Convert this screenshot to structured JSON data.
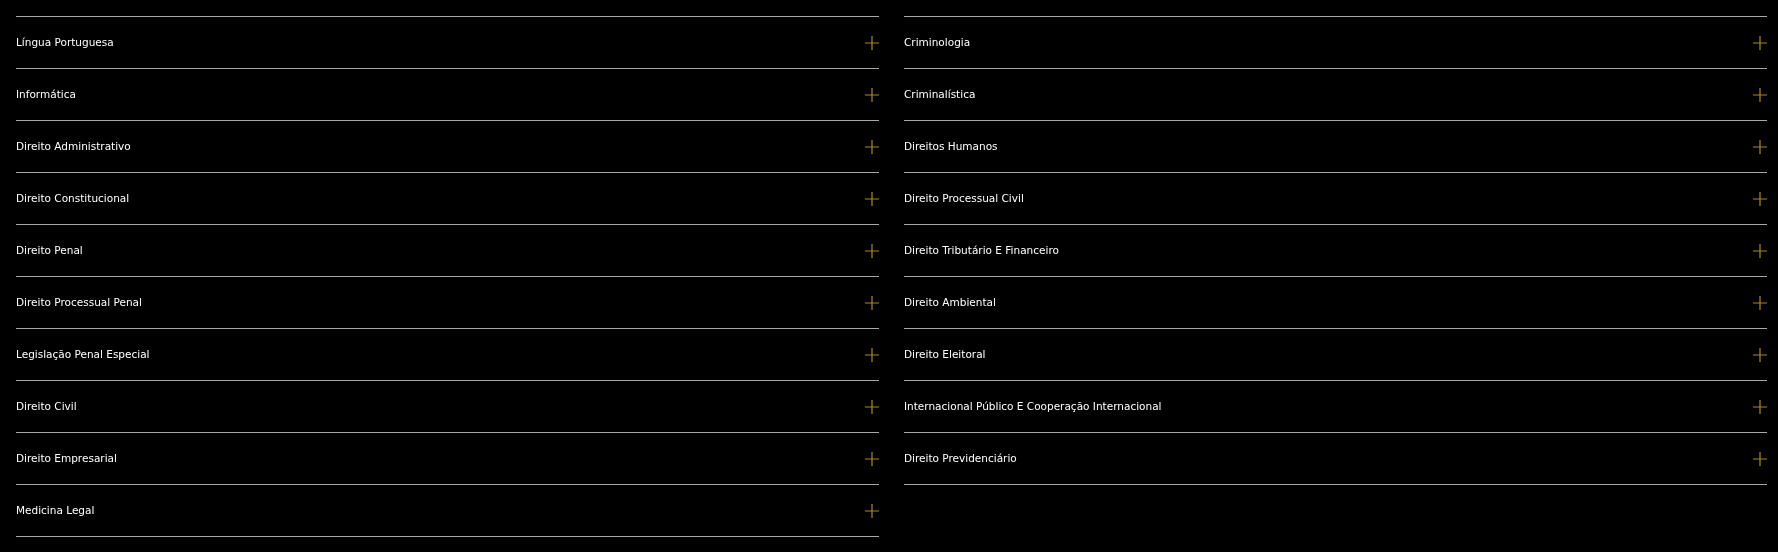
{
  "columns": [
    {
      "items": [
        {
          "label": "Língua Portuguesa",
          "expanded": false
        },
        {
          "label": "Informática",
          "expanded": false
        },
        {
          "label": "Direito Administrativo",
          "expanded": false
        },
        {
          "label": "Direito Constitucional",
          "expanded": false
        },
        {
          "label": "Direito Penal",
          "expanded": false
        },
        {
          "label": "Direito Processual Penal",
          "expanded": false
        },
        {
          "label": "Legislação Penal Especial",
          "expanded": false
        },
        {
          "label": "Direito Civil",
          "expanded": false
        },
        {
          "label": "Direito Empresarial",
          "expanded": false
        },
        {
          "label": "Medicina Legal",
          "expanded": false
        }
      ]
    },
    {
      "items": [
        {
          "label": "Criminologia",
          "expanded": false
        },
        {
          "label": "Criminalística",
          "expanded": false
        },
        {
          "label": "Direitos Humanos",
          "expanded": false
        },
        {
          "label": "Direito Processual Civil",
          "expanded": false
        },
        {
          "label": "Direito Tributário E Financeiro",
          "expanded": false
        },
        {
          "label": "Direito Ambiental",
          "expanded": false
        },
        {
          "label": "Direito Eleitoral",
          "expanded": false
        },
        {
          "label": "Internacional Público E Cooperação Internacional",
          "expanded": false
        },
        {
          "label": "Direito Previdenciário",
          "expanded": false
        }
      ]
    }
  ]
}
